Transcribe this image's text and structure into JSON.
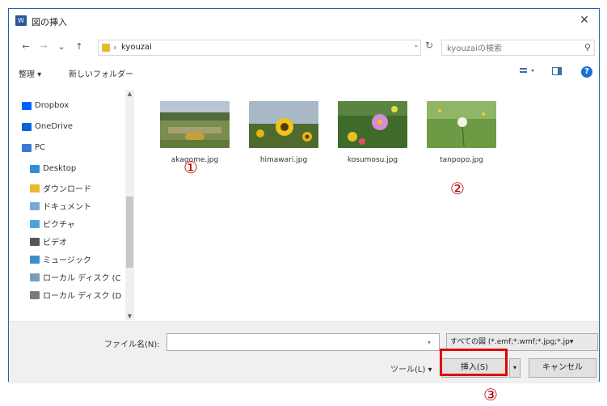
{
  "window": {
    "title": "図の挿入",
    "close": "✕"
  },
  "address": {
    "back": "←",
    "forward": "→",
    "history": "⌄",
    "up": "↑",
    "separator": "›",
    "path": "kyouzai",
    "dropdown": "⌄",
    "refresh": "↻"
  },
  "search": {
    "placeholder": "kyouzaiの検索",
    "icon": "⚲"
  },
  "toolbar": {
    "organize": "整理 ▾",
    "new_folder": "新しいフォルダー",
    "help": "?"
  },
  "nav": {
    "items": [
      {
        "label": "Dropbox",
        "icon": "dropbox-icon",
        "color": "#0061fe"
      },
      {
        "label": "OneDrive",
        "icon": "onedrive-icon",
        "color": "#0a64d6"
      },
      {
        "label": "PC",
        "icon": "pc-icon",
        "color": "#3a7bd5"
      },
      {
        "label": "Desktop",
        "icon": "desktop-icon",
        "color": "#2f8fd8"
      },
      {
        "label": "ダウンロード",
        "icon": "download-folder-icon",
        "color": "#e8b930"
      },
      {
        "label": "ドキュメント",
        "icon": "documents-icon",
        "color": "#7aa9d9"
      },
      {
        "label": "ピクチャ",
        "icon": "pictures-icon",
        "color": "#4ca3dd"
      },
      {
        "label": "ビデオ",
        "icon": "videos-icon",
        "color": "#555555"
      },
      {
        "label": "ミュージック",
        "icon": "music-icon",
        "color": "#3a8fd0"
      },
      {
        "label": "ローカル ディスク (C",
        "icon": "drive-c-icon",
        "color": "#7a9cb8"
      },
      {
        "label": "ローカル ディスク (D",
        "icon": "drive-d-icon",
        "color": "#7a7a7a"
      }
    ]
  },
  "files": [
    {
      "name": "akagome.jpg",
      "marker": "①"
    },
    {
      "name": "himawari.jpg",
      "marker": ""
    },
    {
      "name": "kosumosu.jpg",
      "marker": ""
    },
    {
      "name": "tanpopo.jpg",
      "marker": "②"
    }
  ],
  "bottom": {
    "filename_label": "ファイル名(N):",
    "filename_value": "",
    "filter": "すべての図 (*.emf;*.wmf;*.jpg;*.jp▾",
    "tools": "ツール(L)  ▾",
    "insert": "挿入(S)",
    "cancel": "キャンセル",
    "marker": "③"
  },
  "colors": {
    "accent_border": "#1f64b4",
    "highlight": "#e00000",
    "marker": "#c00000"
  }
}
